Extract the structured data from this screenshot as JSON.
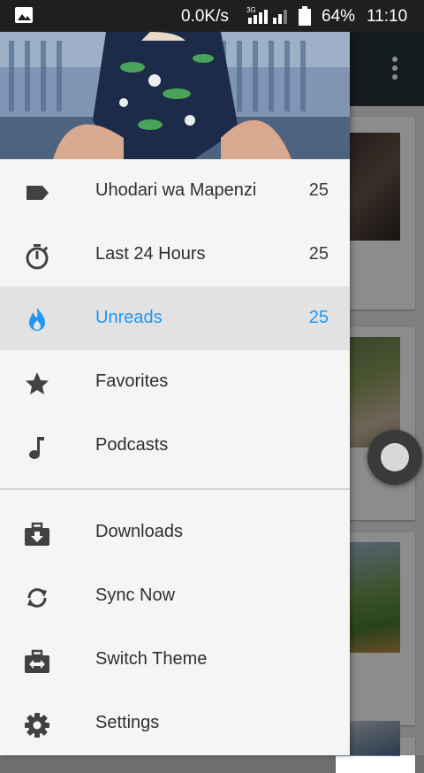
{
  "status_bar": {
    "net_speed": "0.0K/s",
    "network_type": "3G",
    "battery": "64%",
    "time": "11:10"
  },
  "drawer": {
    "primary_items": [
      {
        "label": "Uhodari wa Mapenzi",
        "count": "25",
        "icon": "label-tag-icon"
      },
      {
        "label": "Last 24 Hours",
        "count": "25",
        "icon": "stopwatch-icon"
      },
      {
        "label": "Unreads",
        "count": "25",
        "icon": "flame-icon",
        "active": true
      },
      {
        "label": "Favorites",
        "icon": "star-icon"
      },
      {
        "label": "Podcasts",
        "icon": "music-note-icon"
      }
    ],
    "secondary_items": [
      {
        "label": "Downloads",
        "icon": "download-box-icon"
      },
      {
        "label": "Sync Now",
        "icon": "sync-icon"
      },
      {
        "label": "Switch Theme",
        "icon": "switch-theme-icon"
      },
      {
        "label": "Settings",
        "icon": "gear-icon"
      }
    ]
  },
  "colors": {
    "accent": "#2196f3",
    "drawer_bg": "#f5f5f5",
    "active_bg": "#e2e2e2",
    "toolbar": "#263238"
  }
}
